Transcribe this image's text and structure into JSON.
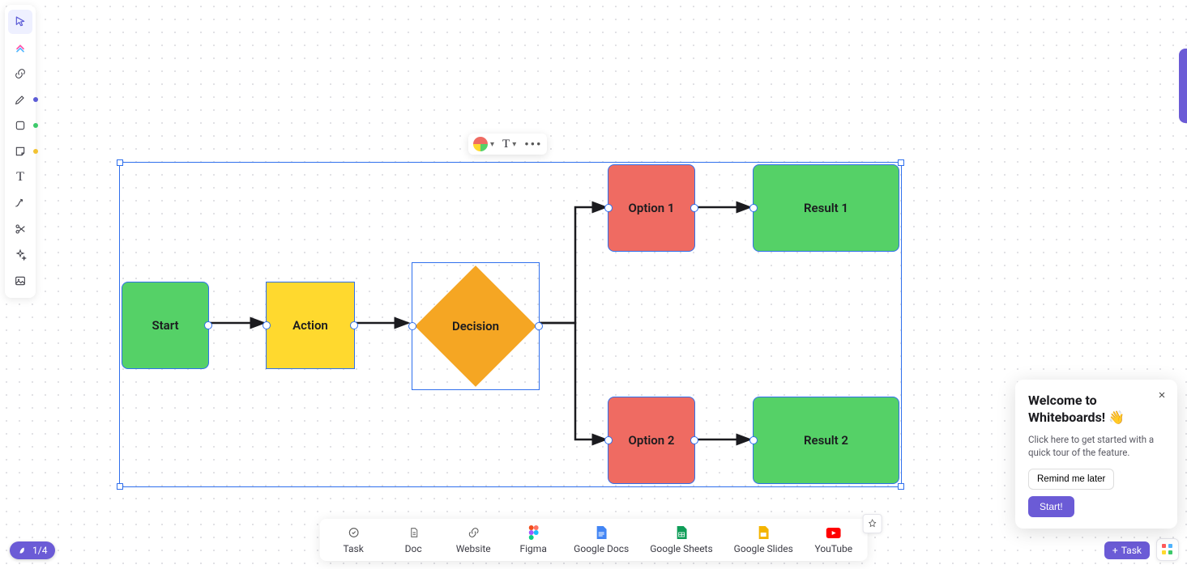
{
  "nodes": {
    "start": {
      "label": "Start",
      "color": "#55d167"
    },
    "action": {
      "label": "Action",
      "color": "#ffd92e"
    },
    "decision": {
      "label": "Decision",
      "color": "#f5a623"
    },
    "option1": {
      "label": "Option 1",
      "color": "#ef6b62"
    },
    "option2": {
      "label": "Option 2",
      "color": "#ef6b62"
    },
    "result1": {
      "label": "Result 1",
      "color": "#55d167"
    },
    "result2": {
      "label": "Result 2",
      "color": "#55d167"
    }
  },
  "context_toolbar": {
    "text_label": "T"
  },
  "dock": {
    "items": [
      {
        "label": "Task"
      },
      {
        "label": "Doc"
      },
      {
        "label": "Website"
      },
      {
        "label": "Figma"
      },
      {
        "label": "Google Docs"
      },
      {
        "label": "Google Sheets"
      },
      {
        "label": "Google Slides"
      },
      {
        "label": "YouTube"
      }
    ]
  },
  "page_badge": "1/4",
  "task_button": "Task",
  "popup": {
    "title": "Welcome to Whiteboards! 👋",
    "body": "Click here to get started with a quick tour of the feature.",
    "remind": "Remind me later",
    "start": "Start!"
  },
  "left_tools": [
    "cursor",
    "clickup",
    "link",
    "pen",
    "shape",
    "sticky",
    "text",
    "connector",
    "scissors",
    "sparkle",
    "image"
  ]
}
